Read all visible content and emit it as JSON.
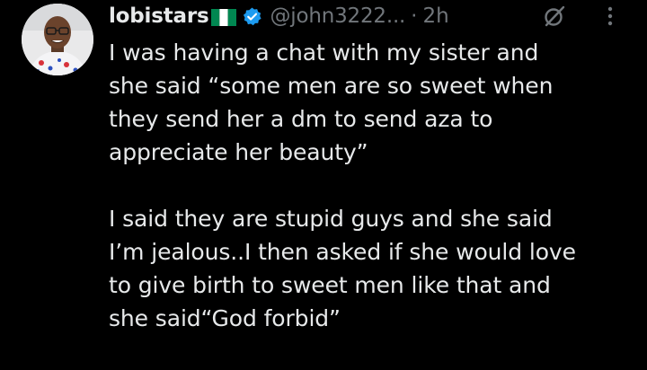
{
  "author": {
    "display_name": "lobistars",
    "flag": "nigeria-flag-icon",
    "verified": "verified-badge-icon",
    "handle": "@john3222...",
    "separator": "·",
    "time": "2h"
  },
  "actions": {
    "grok": "grok-icon",
    "more": "more-options-icon"
  },
  "tweet": {
    "paragraph1": [
      "I was having a chat with my sister and",
      "she said “some men are so sweet when",
      "they send her a dm to send aza to",
      "appreciate her beauty”"
    ],
    "paragraph2": [
      "I said they are stupid guys and she said",
      "I’m jealous..I then asked if she would love",
      "to give birth to sweet men like that and",
      "she said“God forbid”"
    ]
  },
  "colors": {
    "background": "#000000",
    "text": "#e7e9ea",
    "muted": "#71767b",
    "verified": "#1d9bf0",
    "flag_green": "#008751"
  }
}
